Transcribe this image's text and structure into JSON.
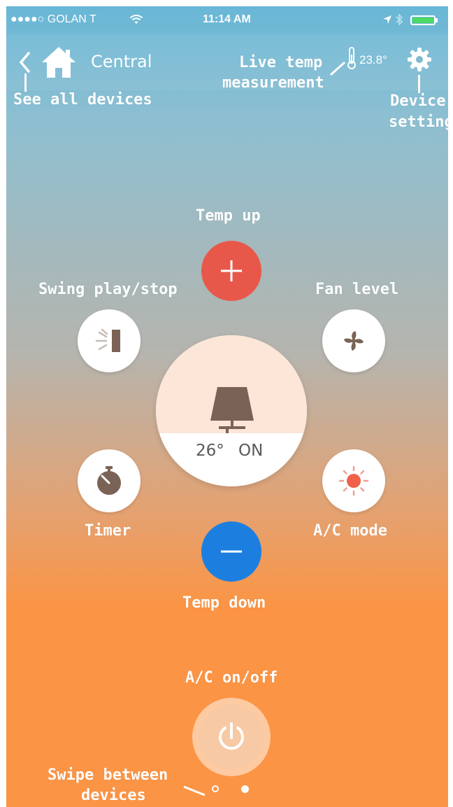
{
  "status_bar": {
    "carrier": "●●●●○ GOLAN T",
    "time": "11:14 AM"
  },
  "header": {
    "device_name": "Central",
    "temperature": "23.8°"
  },
  "annotations": {
    "see_all_devices": "See all devices",
    "live_temp_line1": "Live temp",
    "live_temp_line2": "measurement",
    "device_setting_line1": "Device",
    "device_setting_line2": "setting",
    "temp_up": "Temp up",
    "swing": "Swing play/stop",
    "fan_level": "Fan level",
    "timer": "Timer",
    "ac_mode": "A/C mode",
    "temp_down": "Temp down",
    "ac_onoff": "A/C on/off",
    "swipe_line1": "Swipe between",
    "swipe_line2": "devices"
  },
  "center_display": {
    "temp": "26°",
    "state": "ON"
  },
  "pager": {
    "total": 2,
    "active_index": 1
  },
  "colors": {
    "temp_up": "#e8584a",
    "temp_down": "#1c7fe0",
    "icon_brown": "#7a6356",
    "sun": "#f0604a",
    "center_top": "#fbe6d8"
  }
}
